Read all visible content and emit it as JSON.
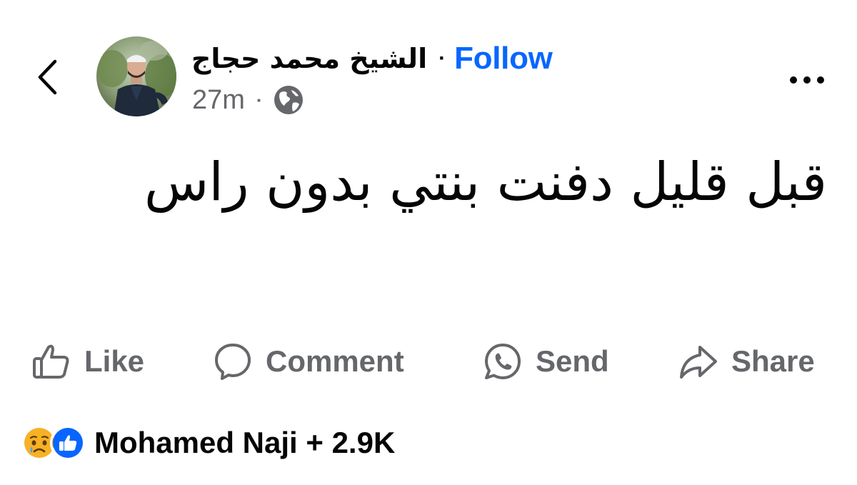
{
  "header": {
    "author_name": "الشيخ محمد حجاج",
    "separator": "·",
    "follow_label": "Follow",
    "time": "27m",
    "meta_separator": "·",
    "privacy_icon": "globe-icon"
  },
  "post": {
    "text": "قبل قليل دفنت بنتي بدون راس"
  },
  "actions": {
    "like_label": "Like",
    "comment_label": "Comment",
    "send_label": "Send",
    "share_label": "Share"
  },
  "reactions": {
    "icons": [
      "sad-reaction-icon",
      "like-reaction-icon"
    ],
    "summary": "Mohamed Naji + 2.9K"
  },
  "colors": {
    "follow": "#0866ff",
    "secondary_text": "#65676b",
    "primary_text": "#050505",
    "like_reaction": "#0866ff",
    "sad_reaction": "#f7b125"
  }
}
